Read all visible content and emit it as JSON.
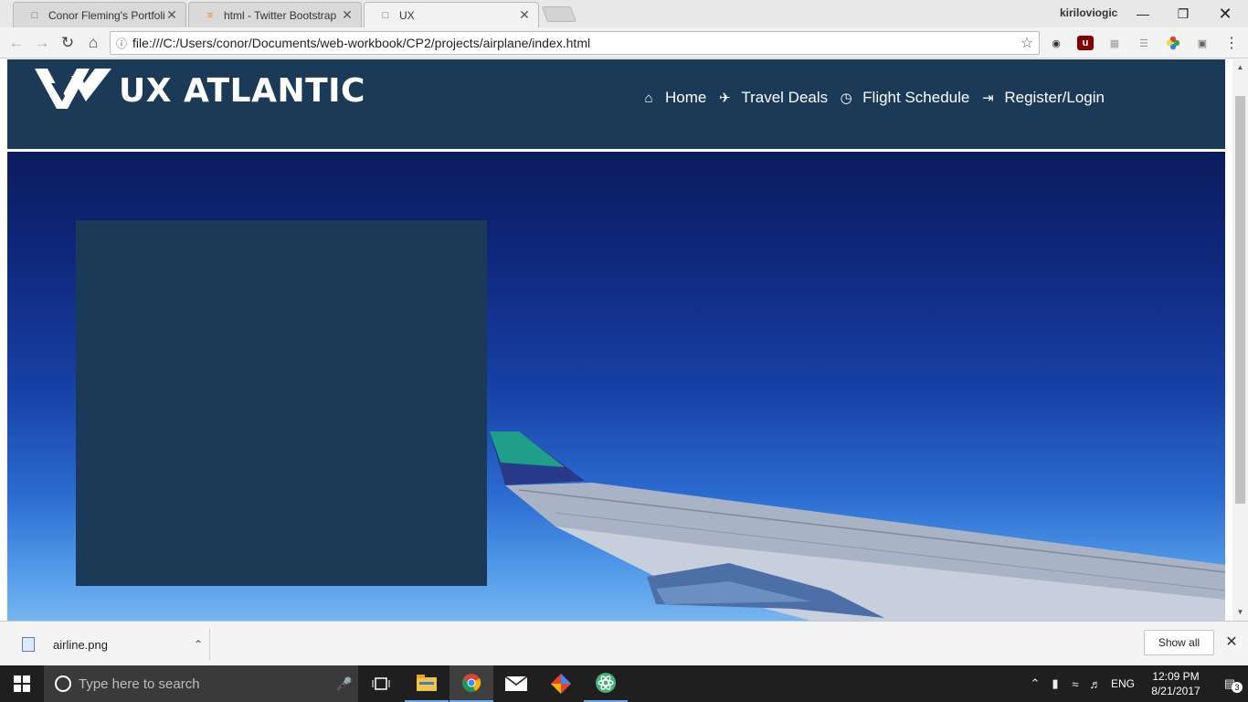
{
  "browser": {
    "tabs": [
      {
        "title": "Conor Fleming's Portfolio",
        "icon": "page-icon"
      },
      {
        "title": "html - Twitter Bootstrap",
        "icon": "stackoverflow-icon"
      },
      {
        "title": "UX",
        "icon": "page-icon"
      }
    ],
    "profile_name": "kiriloviogic",
    "url": "file:///C:/Users/conor/Documents/web-workbook/CP2/projects/airplane/index.html"
  },
  "site": {
    "logo_text": "UX ATLANTIC",
    "nav": [
      {
        "label": "Home",
        "icon": "home-icon"
      },
      {
        "label": "Travel Deals",
        "icon": "plane-icon"
      },
      {
        "label": "Flight Schedule",
        "icon": "clock-icon"
      },
      {
        "label": "Register/Login",
        "icon": "login-icon"
      }
    ],
    "colors": {
      "header": "#1a3a57",
      "panel": "#1a3a57",
      "sky_top": "#0b1b5e",
      "sky_bottom": "#79b8f2"
    }
  },
  "downloads": {
    "file_name": "airline.png",
    "show_all_label": "Show all"
  },
  "taskbar": {
    "search_placeholder": "Type here to search",
    "language": "ENG",
    "time": "12:09 PM",
    "date": "8/21/2017",
    "notification_count": "3"
  }
}
